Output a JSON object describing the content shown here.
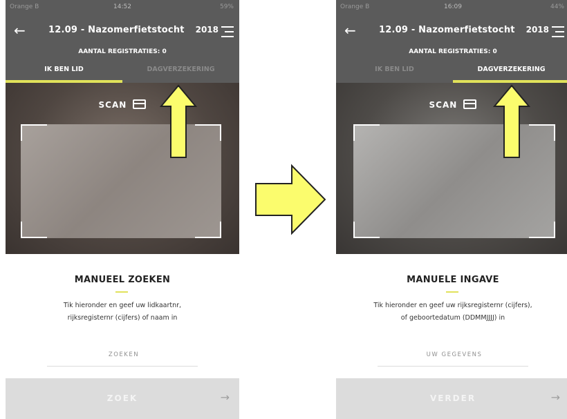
{
  "colors": {
    "accent": "#e1e25a",
    "header": "#5b5b5b",
    "arrow_fill": "#fbfc6d",
    "arrow_stroke": "#222222"
  },
  "screens": [
    {
      "status": {
        "carrier": "Orange B",
        "time": "14:52",
        "battery": "59%"
      },
      "header": {
        "back_icon": "←",
        "title": "12.09 - Nazomerfietstocht",
        "year": "2018",
        "count": "AANTAL REGISTRATIES: 0"
      },
      "tabs": [
        {
          "label": "IK BEN LID"
        },
        {
          "label": "DAGVERZEKERING"
        }
      ],
      "active_tab": 0,
      "scan_label": "SCAN",
      "manual": {
        "title": "MANUEEL ZOEKEN",
        "desc1": "Tik hieronder en geef uw lidkaartnr,",
        "desc2": "rijksregisternr (cijfers) of naam in",
        "placeholder": "ZOEKEN",
        "button": "ZOEK",
        "button_arrow": "→"
      }
    },
    {
      "status": {
        "carrier": "Orange B",
        "time": "16:09",
        "battery": "44%"
      },
      "header": {
        "back_icon": "←",
        "title": "12.09 - Nazomerfietstocht",
        "year": "2018",
        "count": "AANTAL REGISTRATIES: 0"
      },
      "tabs": [
        {
          "label": "IK BEN LID"
        },
        {
          "label": "DAGVERZEKERING"
        }
      ],
      "active_tab": 1,
      "scan_label": "SCAN",
      "manual": {
        "title": "MANUELE INGAVE",
        "desc1": "Tik hieronder en geef uw rijksregisternr (cijfers),",
        "desc2": "of geboortedatum (DDMMJJJJ) in",
        "placeholder": "UW GEGEVENS",
        "button": "VERDER",
        "button_arrow": "→"
      }
    }
  ]
}
